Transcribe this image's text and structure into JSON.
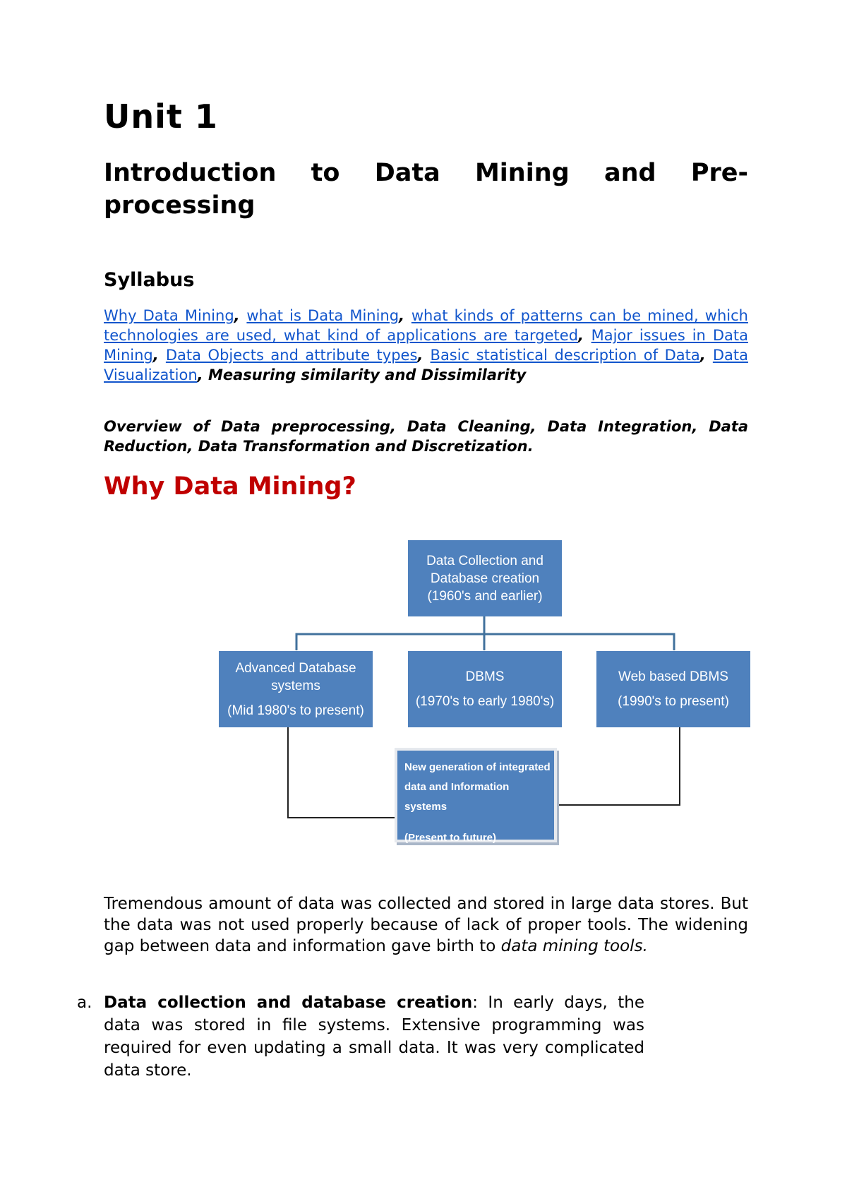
{
  "document": {
    "unit_title": "Unit 1",
    "chapter_title": "Introduction to Data Mining and Pre-processing",
    "syllabus_heading": "Syllabus",
    "syllabus_links": [
      "Why Data Mining",
      "what is Data Mining",
      "what kinds of patterns can be mined, which technologies are used, what kind of applications are targeted",
      "Major issues in Data Mining",
      "Data Objects and attribute types",
      "Basic statistical description of Data",
      "Data Visualization"
    ],
    "syllabus_separator": ", ",
    "syllabus_bold_tail": "Measuring similarity and Dissimilarity",
    "overview_text": "Overview of Data preprocessing, Data Cleaning, Data Integration, Data Reduction, Data Transformation and Discretization.",
    "section_heading": "Why Data Mining?",
    "section_heading_color": "#c00000",
    "link_color": "#1155cc",
    "diagram": {
      "box_color": "#4f81bd",
      "root": {
        "line1": "Data Collection and",
        "line2": "Database creation",
        "line3": "(1960's and earlier)"
      },
      "advanced": {
        "line1": "Advanced Database",
        "line2": "systems",
        "line3": "(Mid 1980's to present)"
      },
      "dbms": {
        "line1": "DBMS",
        "line2": "(1970's to early 1980's)"
      },
      "web": {
        "line1": "Web based DBMS",
        "line2": "(1990's to present)"
      },
      "newgen": {
        "line1": "New generation of integrated",
        "line2": "data and Information systems",
        "line3": "(Present to future)"
      }
    },
    "body_paragraph_main": "Tremendous amount of data was collected and stored in large data stores. But the data was not used properly because of lack of proper tools. The widening gap between data and information gave birth to ",
    "body_paragraph_italic": "data mining tools.",
    "list_items": [
      {
        "marker": "a.",
        "bold": "Data collection and database creation",
        "text": ": In early days, the data was stored in file systems. Extensive programming was required for even updating a small data. It was very complicated data store."
      }
    ]
  }
}
